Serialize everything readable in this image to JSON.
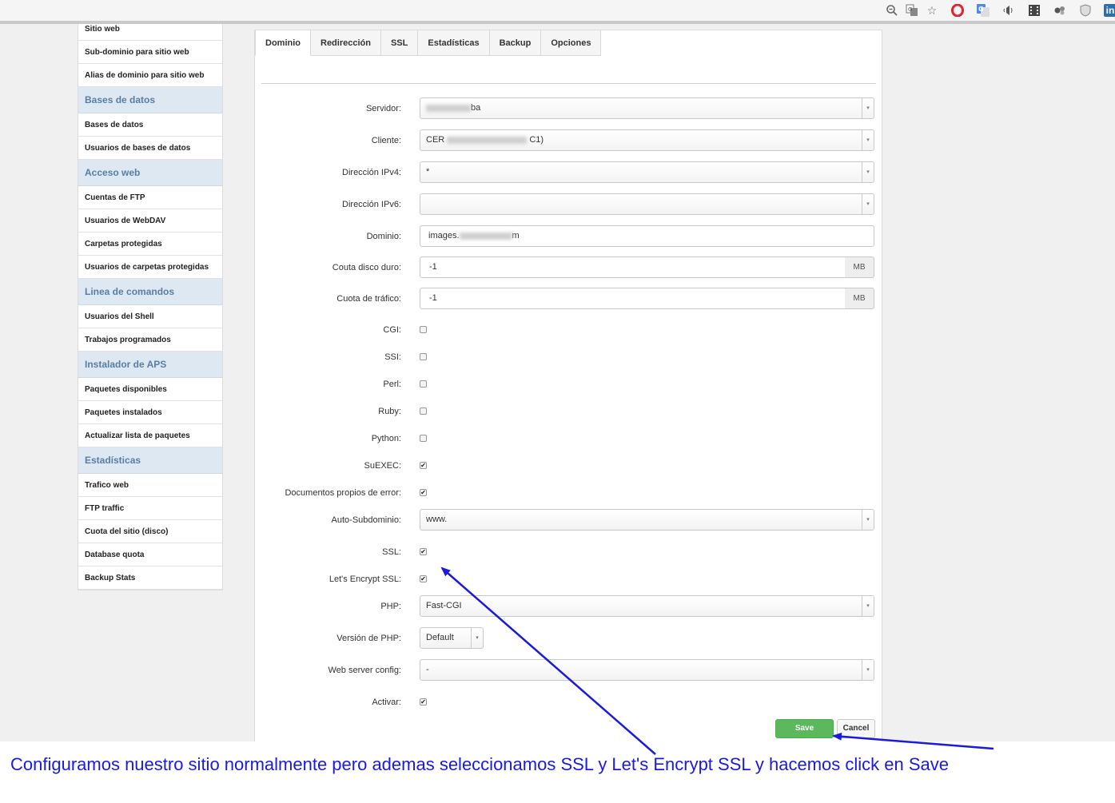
{
  "browser": {
    "icons": [
      "zoom-out-icon",
      "translate-icon",
      "bookmark-star-icon",
      "opera-icon",
      "google-translate-icon",
      "audio-icon",
      "film-icon",
      "extension-icon",
      "shield-icon",
      "linkedin-icon"
    ]
  },
  "sidebar": {
    "items": [
      {
        "type": "item",
        "label": "Sitio web"
      },
      {
        "type": "item",
        "label": "Sub-dominio para sitio web"
      },
      {
        "type": "item",
        "label": "Alias de dominio para sitio web"
      },
      {
        "type": "head",
        "label": "Bases de datos"
      },
      {
        "type": "item",
        "label": "Bases de datos"
      },
      {
        "type": "item",
        "label": "Usuarios de bases de datos"
      },
      {
        "type": "head",
        "label": "Acceso web"
      },
      {
        "type": "item",
        "label": "Cuentas de FTP"
      },
      {
        "type": "item",
        "label": "Usuarios de WebDAV"
      },
      {
        "type": "item",
        "label": "Carpetas protegidas"
      },
      {
        "type": "item",
        "label": "Usuarios de carpetas protegidas"
      },
      {
        "type": "head",
        "label": "Linea de comandos"
      },
      {
        "type": "item",
        "label": "Usuarios del Shell"
      },
      {
        "type": "item",
        "label": "Trabajos programados"
      },
      {
        "type": "head",
        "label": "Instalador de APS"
      },
      {
        "type": "item",
        "label": "Paquetes disponibles"
      },
      {
        "type": "item",
        "label": "Paquetes instalados"
      },
      {
        "type": "item",
        "label": "Actualizar lista de paquetes"
      },
      {
        "type": "head",
        "label": "Estadísticas"
      },
      {
        "type": "item",
        "label": "Trafico web"
      },
      {
        "type": "item",
        "label": "FTP traffic"
      },
      {
        "type": "item",
        "label": "Cuota del sitio (disco)"
      },
      {
        "type": "item",
        "label": "Database quota"
      },
      {
        "type": "item",
        "label": "Backup Stats"
      }
    ]
  },
  "tabs": [
    "Dominio",
    "Redirección",
    "SSL",
    "Estadísticas",
    "Backup",
    "Opciones"
  ],
  "form": {
    "servidor": {
      "label": "Servidor:",
      "value": "ba"
    },
    "cliente": {
      "label": "Cliente:",
      "value_prefix": "CER",
      "value_suffix": "C1)"
    },
    "ipv4": {
      "label": "Dirección IPv4:",
      "value": "*"
    },
    "ipv6": {
      "label": "Dirección IPv6:",
      "value": ""
    },
    "dominio": {
      "label": "Dominio:",
      "value_prefix": "images.",
      "value_suffix": "m"
    },
    "disco": {
      "label": "Couta disco duro:",
      "value": "-1",
      "unit": "MB"
    },
    "trafico": {
      "label": "Cuota de tráfico:",
      "value": "-1",
      "unit": "MB"
    },
    "cgi": {
      "label": "CGI:",
      "checked": false
    },
    "ssi": {
      "label": "SSI:",
      "checked": false
    },
    "perl": {
      "label": "Perl:",
      "checked": false
    },
    "ruby": {
      "label": "Ruby:",
      "checked": false
    },
    "python": {
      "label": "Python:",
      "checked": false
    },
    "suexec": {
      "label": "SuEXEC:",
      "checked": true
    },
    "errdocs": {
      "label": "Documentos propios de error:",
      "checked": true
    },
    "autosub": {
      "label": "Auto-Subdominio:",
      "value": "www."
    },
    "ssl": {
      "label": "SSL:",
      "checked": true
    },
    "letsencrypt": {
      "label": "Let's Encrypt SSL:",
      "checked": true
    },
    "php": {
      "label": "PHP:",
      "value": "Fast-CGI"
    },
    "phpver": {
      "label": "Versión de PHP:",
      "value": "Default"
    },
    "webconf": {
      "label": "Web server config:",
      "value": "-"
    },
    "activar": {
      "label": "Activar:",
      "checked": true
    }
  },
  "buttons": {
    "save": "Save",
    "cancel": "Cancel"
  },
  "annotation": {
    "text": "Configuramos nuestro sitio normalmente pero ademas seleccionamos SSL y Let's Encrypt SSL y hacemos click en Save",
    "color": "#1a1ae0"
  },
  "colors": {
    "accent": "#5cb85c",
    "sidebar_head_bg": "#dde8f3",
    "sidebar_head_text": "#5a7ea3"
  },
  "check_mark": "✔",
  "arrow_glyph": "▾"
}
